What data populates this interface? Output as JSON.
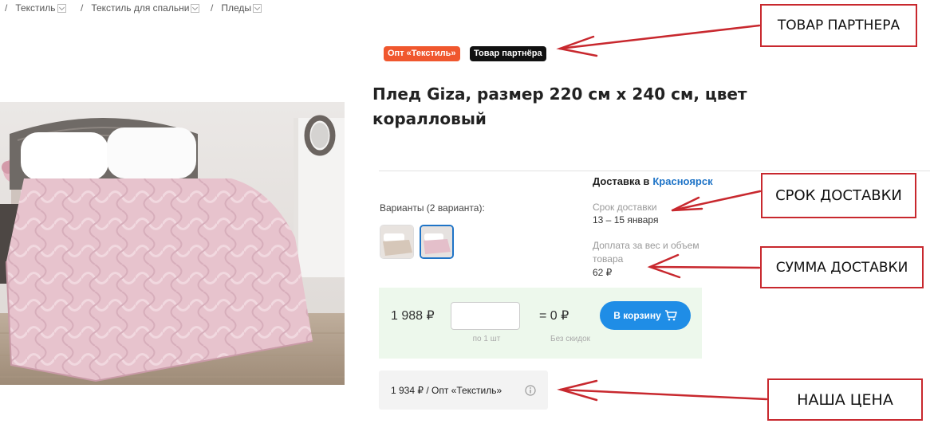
{
  "breadcrumb": {
    "separator": "/",
    "items": [
      {
        "label": "Текстиль"
      },
      {
        "label": "Текстиль для спальни"
      },
      {
        "label": "Пледы"
      }
    ]
  },
  "badges": {
    "seller": "Опт «Текстиль»",
    "partner": "Товар партнёра"
  },
  "product": {
    "title": "Плед Giza, размер 220 см х 240 см, цвет коралловый"
  },
  "variants": {
    "label": "Варианты (2 варианта):",
    "selected": 2
  },
  "delivery": {
    "heading": "Доставка в",
    "city": "Красноярск",
    "term_label": "Срок доставки",
    "term_value": "13 – 15 января",
    "surcharge_label": "Доплата за вес и объем товара",
    "surcharge_value": "62 ₽"
  },
  "purchase": {
    "price": "1 988 ₽",
    "quantity_value": "",
    "quantity_note": "по 1 шт",
    "total": "= 0 ₽",
    "discount_note": "Без скидок",
    "cart_button_label": "В корзину"
  },
  "our_price": {
    "text": "1 934 ₽ / Опт «Текстиль»"
  },
  "callouts": {
    "partner": "ТОВАР ПАРТНЕРА",
    "delivery_term": "СРОК ДОСТАВКИ",
    "delivery_sum": "СУММА ДОСТАВКИ",
    "our_price": "НАША ЦЕНА"
  },
  "colors": {
    "seller_badge": "#f0572e",
    "partner_badge": "#111111",
    "accent_blue": "#1f74c7",
    "cart_button": "#1f8de6",
    "buy_box": "#edf8ec",
    "callout_border": "#c8282e"
  }
}
